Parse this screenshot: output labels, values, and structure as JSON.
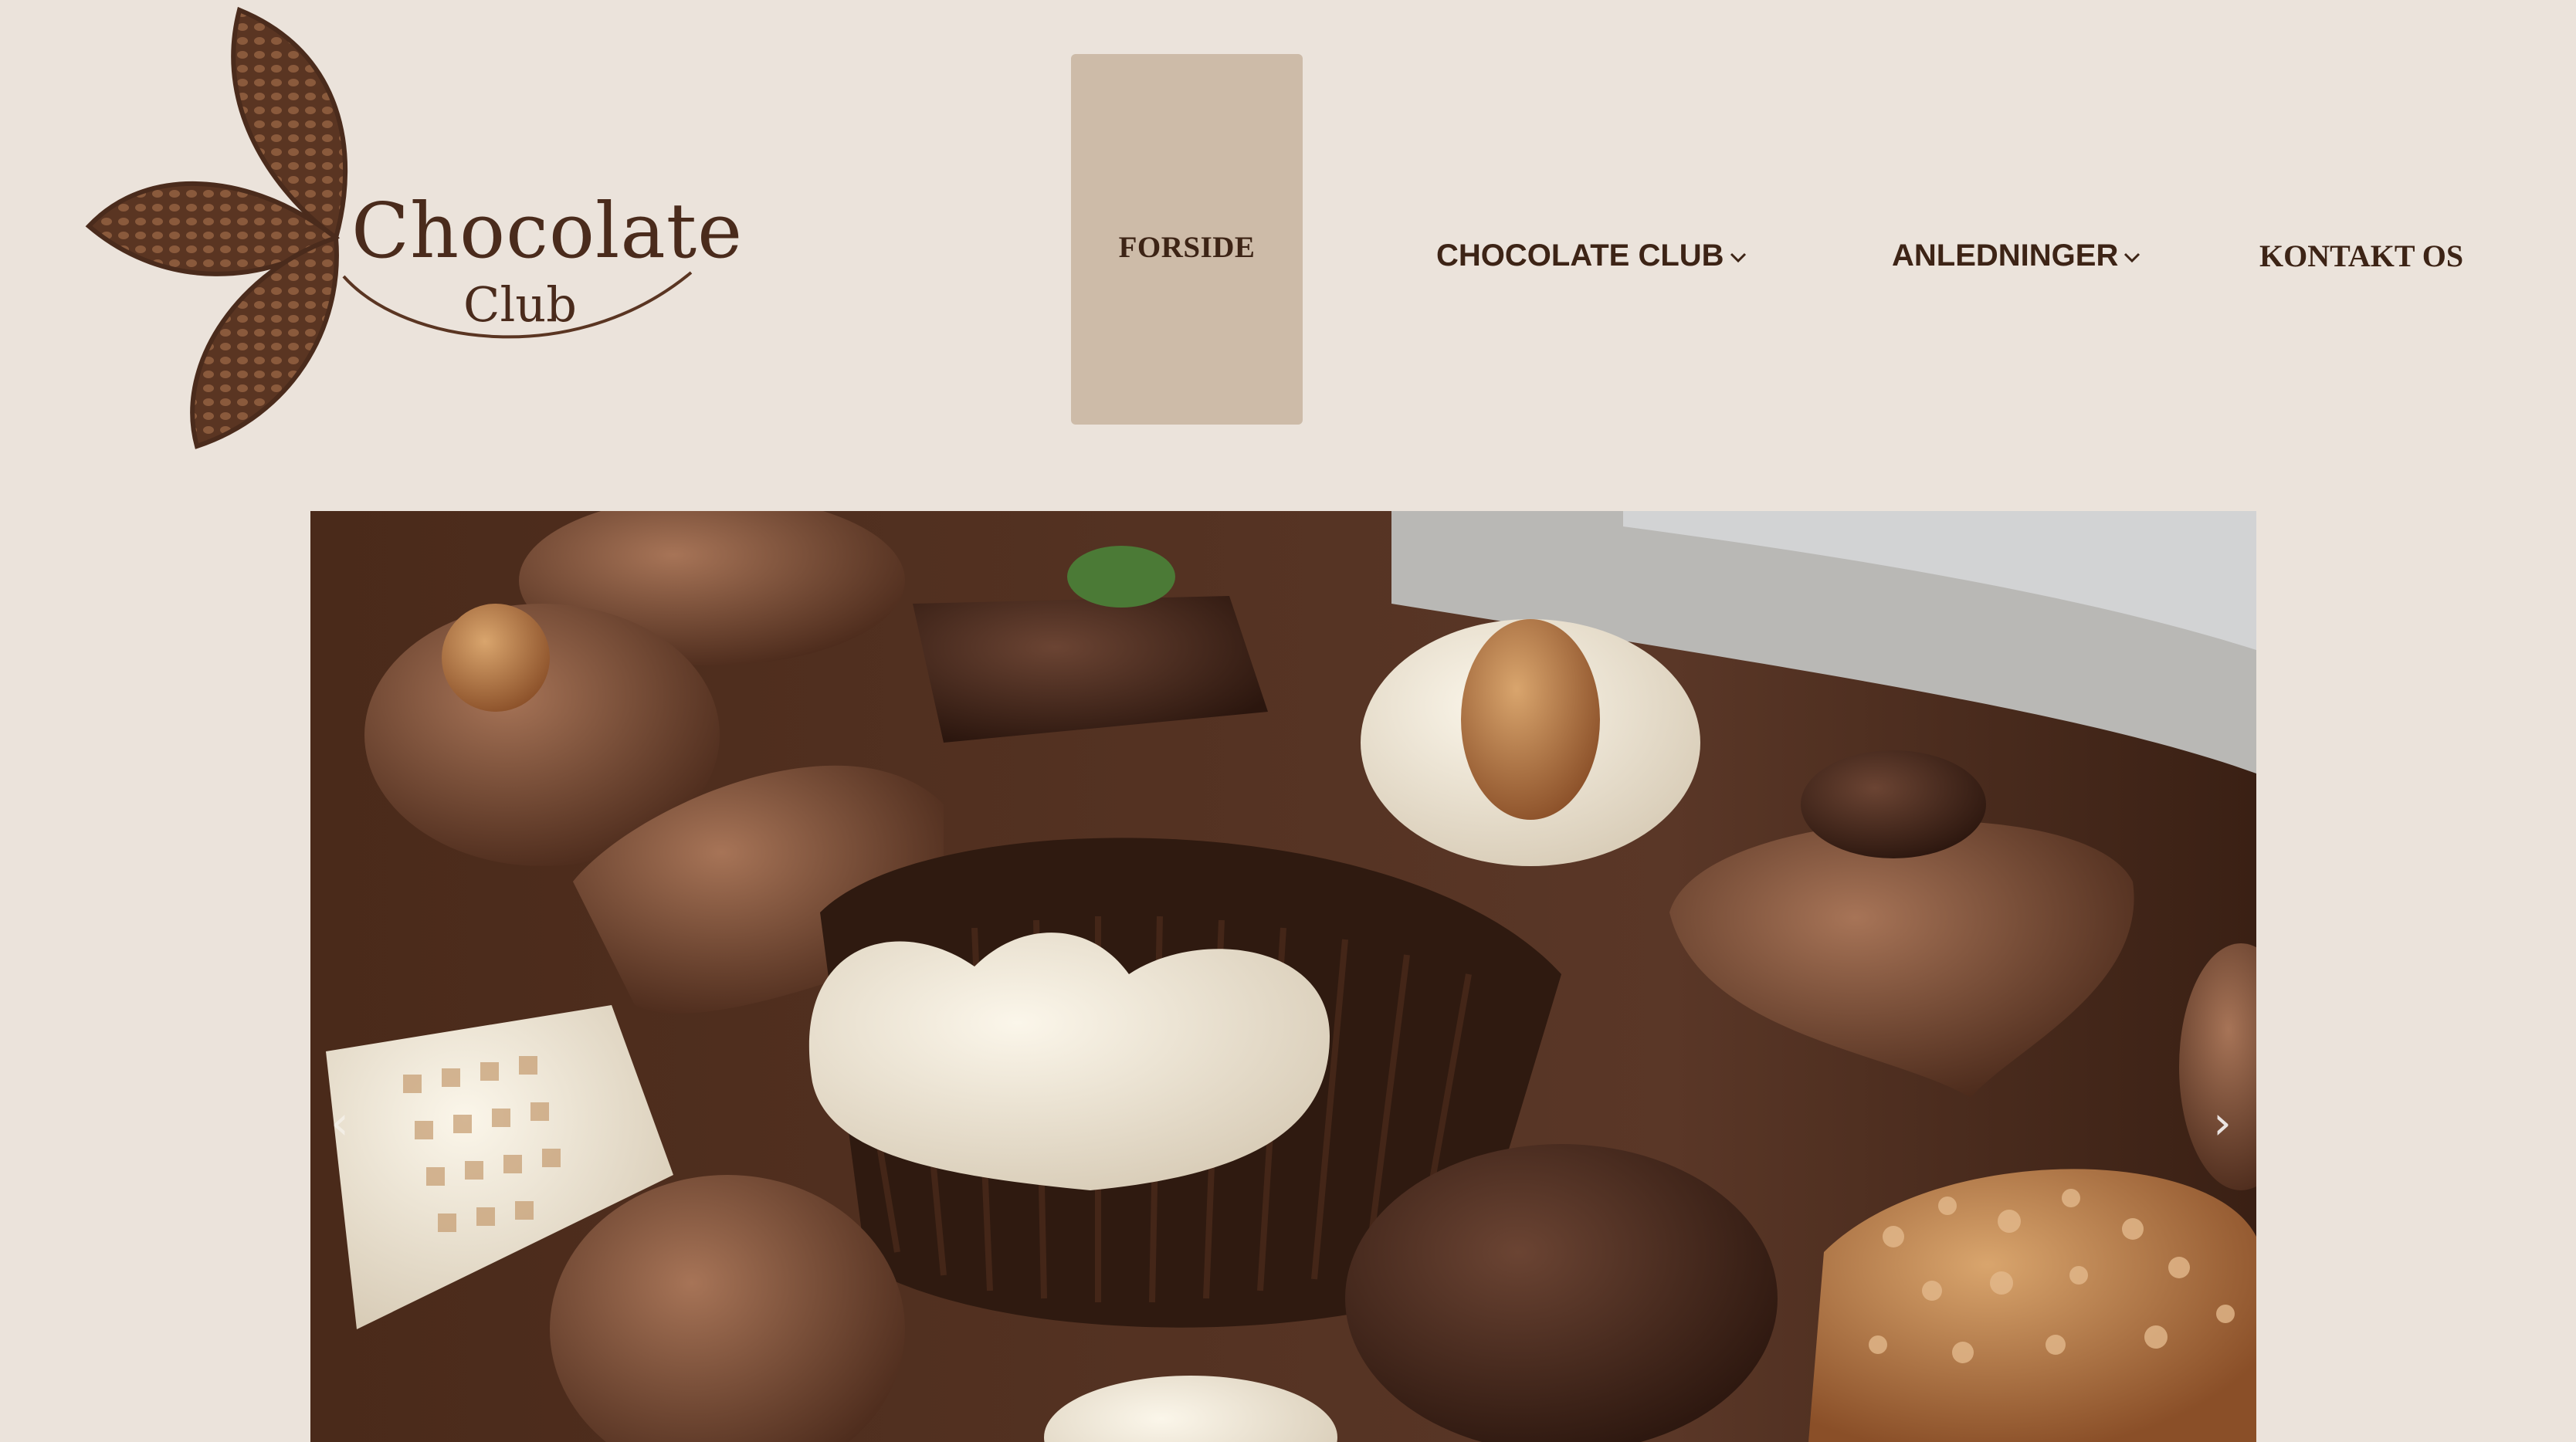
{
  "brand": {
    "logo_word": "Chocolate",
    "logo_sub": "Club",
    "colors": {
      "background": "#ebe3db",
      "active_tab": "#cdbba8",
      "text": "#3d2416",
      "logo": "#5a3522"
    }
  },
  "nav": {
    "home": "FORSIDE",
    "club": "CHOCOLATE CLUB",
    "occasions": "ANLEDNINGER",
    "contact": "KONTAKT OS",
    "dropdown_icon": "chevron-down-icon"
  },
  "hero": {
    "image": "assorted-chocolate-pralines-photo",
    "prev_glyph": "‹",
    "next_glyph": "›"
  }
}
